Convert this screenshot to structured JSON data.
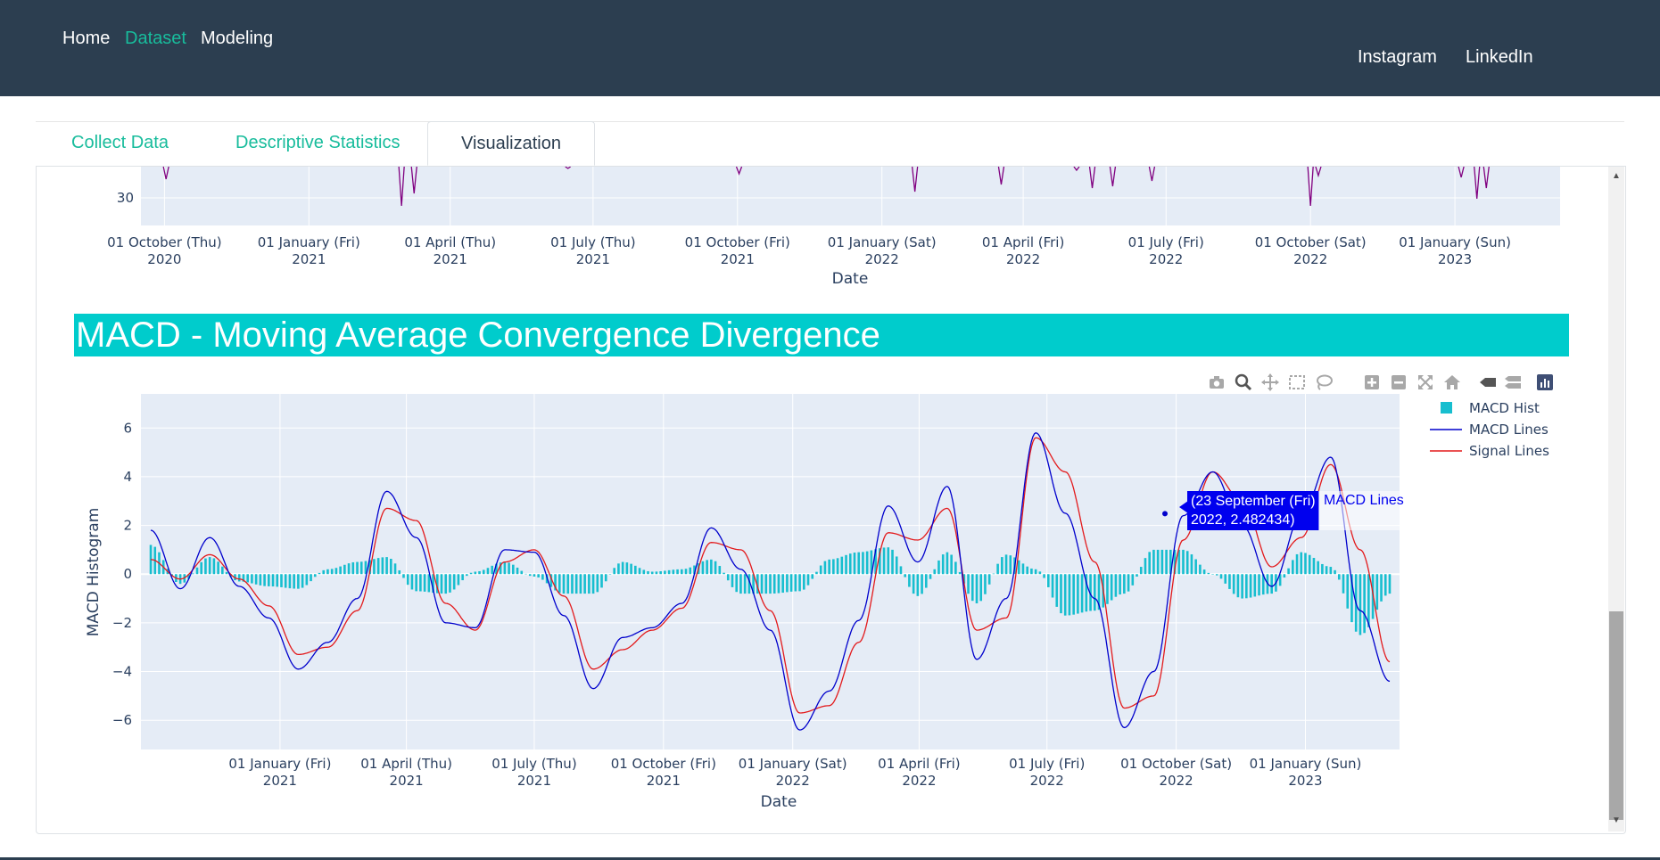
{
  "nav": {
    "home": "Home",
    "dataset": "Dataset",
    "modeling": "Modeling",
    "instagram": "Instagram",
    "linkedin": "LinkedIn"
  },
  "tabs": [
    "Collect Data",
    "Descriptive Statistics",
    "Visualization"
  ],
  "active_tab": "Visualization",
  "colors": {
    "navbar": "#2c3e50",
    "accent": "#18bc9c",
    "banner": "#00cccc",
    "hist": "#17becf",
    "macd": "#0000cc",
    "signal": "#e31a1c",
    "upper_line": "#800080"
  },
  "macd": {
    "section_title": "MACD - Moving Average Convergence Divergence",
    "tooltip_line1": "(23 September (Fri)",
    "tooltip_line2": "2022, 2.482434)",
    "tooltip_series": "MACD Lines"
  },
  "toolbar_icons": [
    "camera-icon",
    "zoom-icon",
    "pan-icon",
    "box-select-icon",
    "lasso-icon",
    "zoom-in-icon",
    "zoom-out-icon",
    "autoscale-icon",
    "reset-axes-icon",
    "hover-closest-icon",
    "hover-compare-icon",
    "plotly-logo-icon"
  ],
  "chart_data": [
    {
      "type": "line",
      "title": "",
      "xlabel": "Date",
      "ylabel": "",
      "y_tick_visible": [
        "30"
      ],
      "x_ticks": [
        [
          "01 October (Thu)",
          "2020"
        ],
        [
          "01 January (Fri)",
          "2021"
        ],
        [
          "01 April (Thu)",
          "2021"
        ],
        [
          "01 July (Thu)",
          "2021"
        ],
        [
          "01 October (Fri)",
          "2021"
        ],
        [
          "01 January (Sat)",
          "2022"
        ],
        [
          "01 April (Fri)",
          "2022"
        ],
        [
          "01 July (Fri)",
          "2022"
        ],
        [
          "01 October (Sat)",
          "2022"
        ],
        [
          "01 January (Sun)",
          "2023"
        ]
      ],
      "note": "partially scrolled out of view"
    },
    {
      "type": "line",
      "title": "",
      "xlabel": "Date",
      "ylabel": "MACD Histogram",
      "ylim": [
        -7.2,
        7.4
      ],
      "y_ticks": [
        "6",
        "4",
        "2",
        "0",
        "−2",
        "−4",
        "−6"
      ],
      "x_ticks": [
        [
          "01 January (Fri)",
          "2021"
        ],
        [
          "01 April (Thu)",
          "2021"
        ],
        [
          "01 July (Thu)",
          "2021"
        ],
        [
          "01 October (Fri)",
          "2021"
        ],
        [
          "01 January (Sat)",
          "2022"
        ],
        [
          "01 April (Fri)",
          "2022"
        ],
        [
          "01 July (Fri)",
          "2022"
        ],
        [
          "01 October (Sat)",
          "2022"
        ],
        [
          "01 January (Sun)",
          "2023"
        ]
      ],
      "legend": [
        "MACD Hist",
        "MACD Lines",
        "Signal Lines"
      ],
      "legend_position": "top-right",
      "x_dates": [
        "2020-10-01",
        "2020-10-22",
        "2020-11-12",
        "2020-12-03",
        "2020-12-24",
        "2021-01-14",
        "2021-02-04",
        "2021-02-25",
        "2021-03-18",
        "2021-04-08",
        "2021-04-29",
        "2021-05-20",
        "2021-06-10",
        "2021-07-01",
        "2021-07-22",
        "2021-08-12",
        "2021-09-02",
        "2021-09-23",
        "2021-10-14",
        "2021-11-04",
        "2021-11-25",
        "2021-12-16",
        "2022-01-06",
        "2022-01-27",
        "2022-02-17",
        "2022-03-10",
        "2022-03-31",
        "2022-04-21",
        "2022-05-12",
        "2022-06-02",
        "2022-06-23",
        "2022-07-14",
        "2022-08-04",
        "2022-08-25",
        "2022-09-15",
        "2022-10-06",
        "2022-10-27",
        "2022-11-17",
        "2022-12-08",
        "2022-12-29",
        "2023-01-19",
        "2023-02-09",
        "2023-03-02"
      ],
      "series": [
        {
          "name": "MACD Lines",
          "values": [
            1.8,
            -0.6,
            1.5,
            -0.5,
            -1.8,
            -3.9,
            -2.8,
            -1.0,
            3.4,
            1.5,
            -2.0,
            -2.2,
            1.0,
            0.9,
            -1.7,
            -4.7,
            -2.6,
            -2.2,
            -1.2,
            1.9,
            0.2,
            -2.3,
            -6.4,
            -4.8,
            -1.9,
            2.8,
            0.5,
            3.6,
            -3.5,
            -1.0,
            5.8,
            2.5,
            -1.0,
            -6.3,
            -4.0,
            2.4,
            4.2,
            2.0,
            -0.5,
            2.4,
            4.8,
            -1.5,
            -4.4
          ]
        },
        {
          "name": "Signal Lines",
          "values": [
            0.6,
            -0.2,
            0.8,
            -0.2,
            -1.3,
            -3.3,
            -3.0,
            -1.5,
            2.7,
            2.2,
            -1.2,
            -2.3,
            0.5,
            1.0,
            -0.9,
            -3.9,
            -3.1,
            -2.3,
            -1.4,
            1.3,
            1.0,
            -1.5,
            -5.7,
            -5.4,
            -2.8,
            1.7,
            1.4,
            2.7,
            -2.3,
            -1.8,
            5.6,
            4.2,
            0.5,
            -5.5,
            -5.0,
            1.4,
            4.2,
            3.0,
            0.3,
            1.5,
            4.5,
            1.0,
            -3.6
          ]
        },
        {
          "name": "MACD Hist",
          "values": [
            1.2,
            -0.4,
            0.7,
            -0.3,
            -0.5,
            -0.6,
            0.2,
            0.5,
            0.7,
            -0.7,
            -0.8,
            0.1,
            0.5,
            -0.1,
            -0.8,
            -0.8,
            0.5,
            0.1,
            0.2,
            0.6,
            -0.8,
            -0.8,
            -0.7,
            0.6,
            0.9,
            1.1,
            -0.9,
            0.9,
            -1.2,
            0.8,
            0.2,
            -1.7,
            -1.5,
            -0.8,
            1.0,
            1.0,
            0.0,
            -1.0,
            -0.8,
            0.9,
            0.3,
            -2.5,
            -0.8
          ]
        }
      ],
      "tooltip_point": {
        "x": "2022-09-23",
        "y": 2.482434,
        "series": "MACD Lines"
      }
    }
  ]
}
